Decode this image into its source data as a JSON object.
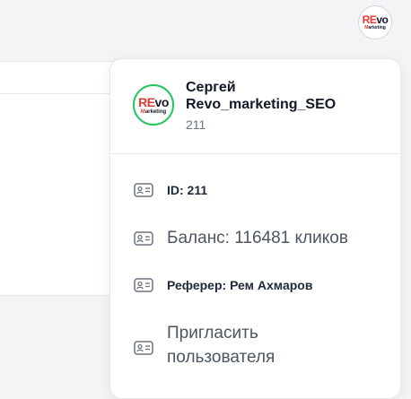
{
  "header": {
    "logo_main_red": "RE",
    "logo_main_dark": "vo",
    "logo_sub_red": "M",
    "logo_sub_dark": "arketing"
  },
  "profile": {
    "name": "Сергей",
    "login": "Revo_marketing_SEO",
    "user_id": "211"
  },
  "menu": {
    "id_label": "ID: 211",
    "balance_label": "Баланс: 116481 кликов",
    "referer_label": "Реферер: Рем Ахмаров",
    "invite_label": "Пригласить пользователя"
  },
  "colors": {
    "brand_red": "#e53935",
    "avatar_ring": "#22c55e",
    "text_dark": "#111827",
    "text_muted": "#6b7280"
  },
  "icons": {
    "menu_item_icon": "id-card-icon"
  }
}
